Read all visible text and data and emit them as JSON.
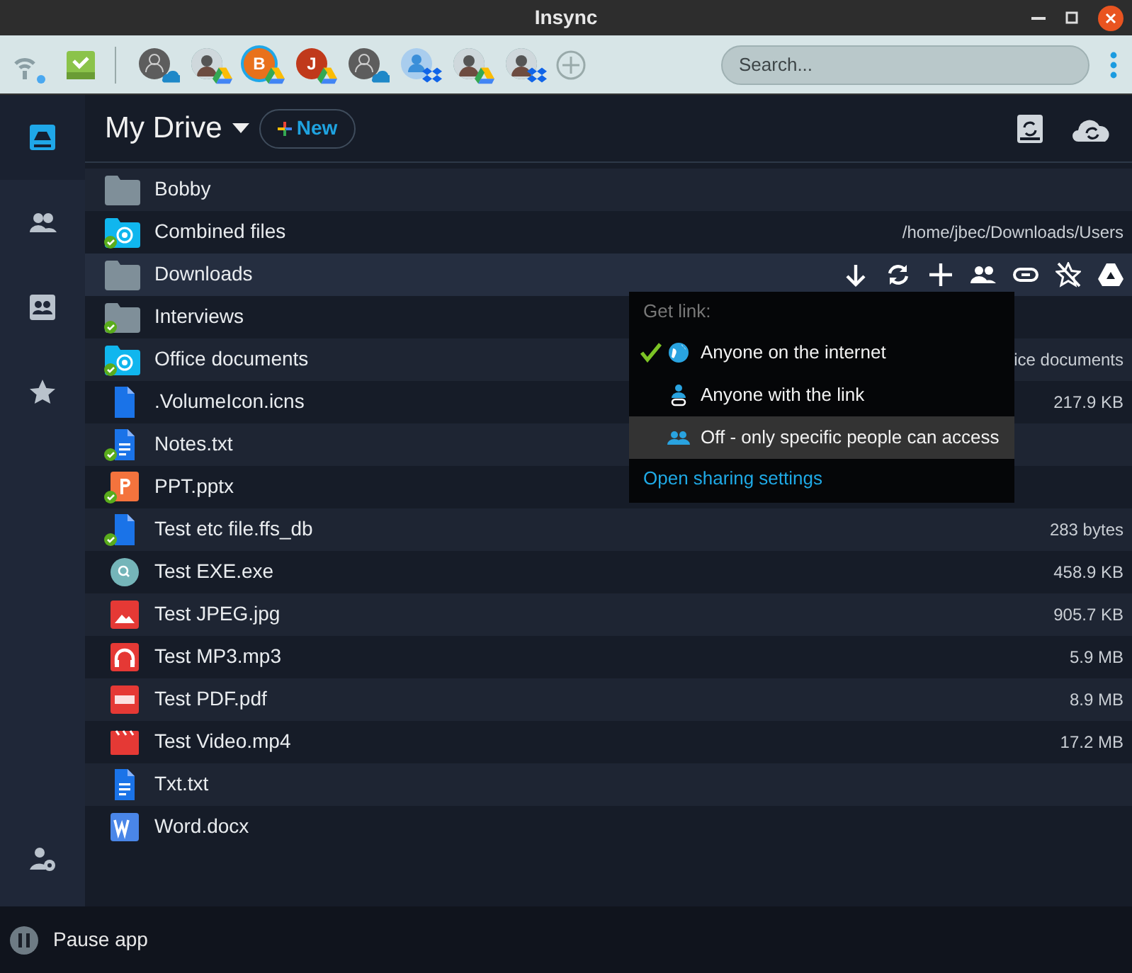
{
  "window": {
    "title": "Insync"
  },
  "toolbar": {
    "accounts": [
      {
        "kind": "onedrive",
        "selected": false
      },
      {
        "kind": "gdrive",
        "selected": false
      },
      {
        "kind": "gdrive",
        "letter": "B",
        "color": "#e8711c",
        "selected": true
      },
      {
        "kind": "gdrive",
        "letter": "J",
        "color": "#c0391b",
        "selected": false
      },
      {
        "kind": "onedrive",
        "selected": false
      },
      {
        "kind": "dropbox",
        "selected": false
      },
      {
        "kind": "gdrive",
        "selected": false
      },
      {
        "kind": "dropbox",
        "selected": false
      }
    ],
    "search": {
      "placeholder": "Search..."
    }
  },
  "sidebar": {
    "items": [
      {
        "kind": "drive",
        "selected": true
      },
      {
        "kind": "people",
        "selected": false
      },
      {
        "kind": "shared",
        "selected": false
      },
      {
        "kind": "star",
        "selected": false
      }
    ]
  },
  "header": {
    "title": "My Drive",
    "new_button": "New"
  },
  "rows": [
    {
      "name": "Bobby",
      "kind": "folder",
      "synced": false,
      "selected": false
    },
    {
      "name": "Combined files",
      "kind": "shared-folder",
      "synced": true,
      "selected": false,
      "detail": "/home/jbec/Downloads/Users"
    },
    {
      "name": "Downloads",
      "kind": "folder",
      "synced": false,
      "selected": true
    },
    {
      "name": "Interviews",
      "kind": "folder",
      "synced": true,
      "selected": false
    },
    {
      "name": "Office documents",
      "kind": "shared-folder",
      "synced": true,
      "selected": false,
      "detail": "ice documents"
    },
    {
      "name": ".VolumeIcon.icns",
      "kind": "file",
      "synced": false,
      "selected": false,
      "detail": "217.9 KB"
    },
    {
      "name": "Notes.txt",
      "kind": "text",
      "synced": true,
      "selected": false
    },
    {
      "name": "PPT.pptx",
      "kind": "slides",
      "synced": true,
      "selected": false
    },
    {
      "name": "Test etc file.ffs_db",
      "kind": "file",
      "synced": true,
      "selected": false,
      "detail": "283 bytes"
    },
    {
      "name": "Test EXE.exe",
      "kind": "exe",
      "synced": false,
      "selected": false,
      "detail": "458.9 KB"
    },
    {
      "name": "Test JPEG.jpg",
      "kind": "image",
      "synced": false,
      "selected": false,
      "detail": "905.7 KB"
    },
    {
      "name": "Test MP3.mp3",
      "kind": "audio",
      "synced": false,
      "selected": false,
      "detail": "5.9 MB"
    },
    {
      "name": "Test PDF.pdf",
      "kind": "pdf",
      "synced": false,
      "selected": false,
      "detail": "8.9 MB"
    },
    {
      "name": "Test Video.mp4",
      "kind": "video",
      "synced": false,
      "selected": false,
      "detail": "17.2 MB"
    },
    {
      "name": "Txt.txt",
      "kind": "text",
      "synced": false,
      "selected": false
    },
    {
      "name": "Word.docx",
      "kind": "word",
      "synced": false,
      "selected": false
    }
  ],
  "link_menu": {
    "title": "Get link:",
    "options": [
      {
        "label": "Anyone on the internet",
        "kind": "globe",
        "checked": true,
        "selected": false
      },
      {
        "label": "Anyone with the link",
        "kind": "link",
        "checked": false,
        "selected": false
      },
      {
        "label": "Off - only specific people can access",
        "kind": "people",
        "checked": false,
        "selected": true
      }
    ],
    "footer_link": "Open sharing settings"
  },
  "status_bar": {
    "pause_label": "Pause app"
  }
}
